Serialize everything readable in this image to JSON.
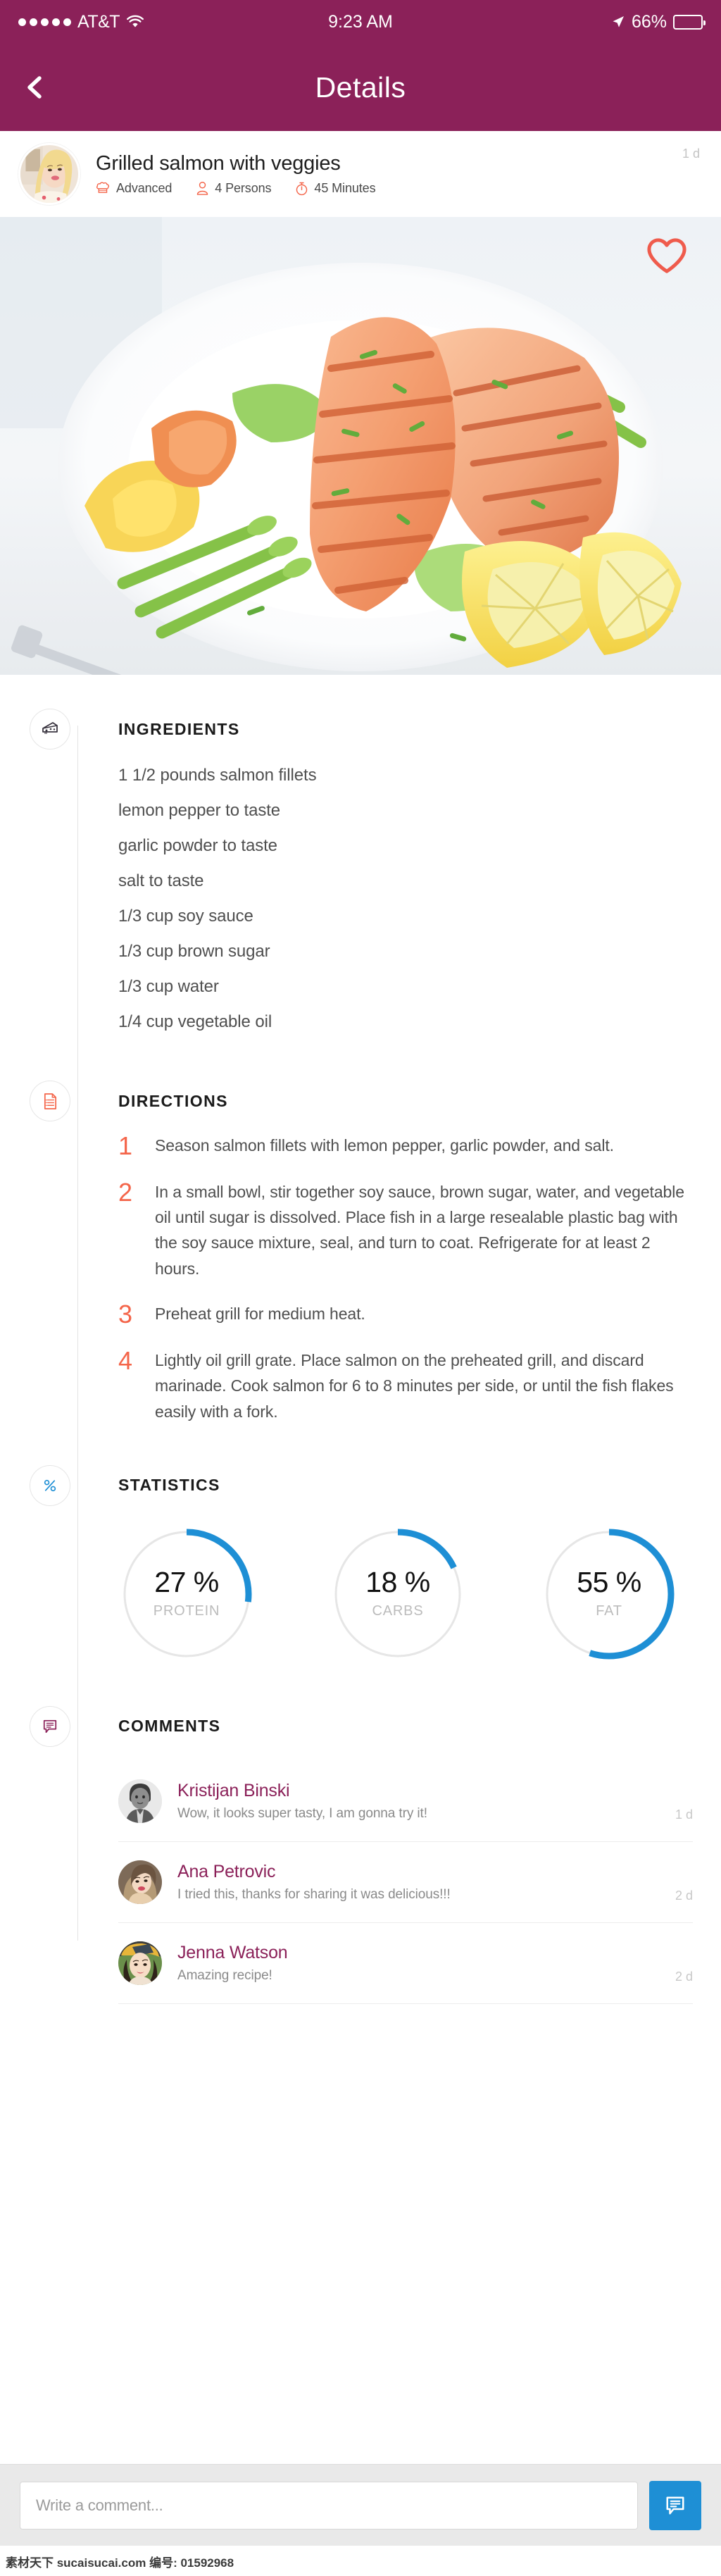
{
  "theme": {
    "brand": "#8B2159",
    "accent_coral": "#F4654A",
    "accent_blue": "#1E8FD5",
    "text_dark": "#1e1e1e",
    "text_muted": "#8a8a8a"
  },
  "status_bar": {
    "signal_dots": 5,
    "carrier": "AT&T",
    "wifi_icon": "wifi-icon",
    "time": "9:23 AM",
    "location_icon": "location-arrow-icon",
    "battery_percent": "66%",
    "battery_level": 66
  },
  "nav": {
    "back_icon": "chevron-left-icon",
    "title": "Details"
  },
  "recipe_header": {
    "avatar_icon": "author-avatar",
    "title": "Grilled salmon with veggies",
    "time_ago": "1 d",
    "meta": [
      {
        "icon": "chef-hat-icon",
        "label": "Advanced"
      },
      {
        "icon": "person-icon",
        "label": "4 Persons"
      },
      {
        "icon": "timer-icon",
        "label": "45 Minutes"
      }
    ]
  },
  "hero": {
    "alt": "Grilled salmon fillets with asparagus, snow peas and lemon wedges on a white plate",
    "favorite_icon": "heart-outline-icon",
    "favorited": false
  },
  "sections": {
    "ingredients": {
      "icon": "cheese-icon",
      "title": "INGREDIENTS",
      "items": [
        "1 1/2 pounds salmon fillets",
        "lemon pepper to taste",
        "garlic powder to taste",
        "salt to taste",
        "1/3 cup soy sauce",
        "1/3 cup brown sugar",
        "1/3 cup water",
        "1/4 cup vegetable oil"
      ]
    },
    "directions": {
      "icon": "document-list-icon",
      "title": "DIRECTIONS",
      "steps": [
        {
          "num": "1",
          "text": "Season salmon fillets with lemon pepper, garlic powder, and salt."
        },
        {
          "num": "2",
          "text": "In a small bowl, stir together soy sauce, brown sugar, water, and vegetable oil until sugar is dissolved. Place fish in a large resealable plastic bag with the soy sauce mixture, seal, and turn to coat. Refrigerate for at least 2 hours."
        },
        {
          "num": "3",
          "text": "Preheat grill for medium heat."
        },
        {
          "num": "4",
          "text": "Lightly oil grill grate. Place salmon on the preheated grill, and discard marinade. Cook salmon for 6 to 8 minutes per side, or until the fish flakes easily with a fork."
        }
      ]
    },
    "statistics": {
      "icon": "percent-icon",
      "title": "STATISTICS"
    },
    "comments": {
      "icon": "speech-bubble-icon",
      "title": "COMMENTS",
      "items": [
        {
          "avatar": "avatar-male-1",
          "name": "Kristijan Binski",
          "text": "Wow, it looks super tasty, I am gonna try it!",
          "time": "1 d"
        },
        {
          "avatar": "avatar-female-1",
          "name": "Ana Petrovic",
          "text": "I tried this, thanks for sharing it was delicious!!!",
          "time": "2 d"
        },
        {
          "avatar": "avatar-female-2",
          "name": "Jenna Watson",
          "text": "Amazing recipe!",
          "time": "2 d"
        }
      ]
    }
  },
  "chart_data": {
    "type": "pie",
    "title": "STATISTICS",
    "subtype": "donut-gauges",
    "unit": "%",
    "categories": [
      "PROTEIN",
      "CARBS",
      "FAT"
    ],
    "values": [
      27,
      18,
      55
    ],
    "labels": [
      "27 %",
      "18 %",
      "55 %"
    ],
    "track_color": "#e6e6e6",
    "arc_color": "#1E8FD5",
    "start_angle_deg": 0,
    "direction": "clockwise",
    "max": 100,
    "legend": "none",
    "grid": false
  },
  "bottom_bar": {
    "input_value": "",
    "input_placeholder": "Write a comment...",
    "send_icon": "speech-bubble-icon",
    "send_label": "Send comment"
  },
  "watermark": "素材天下 sucaisucai.com  编号: 01592968"
}
